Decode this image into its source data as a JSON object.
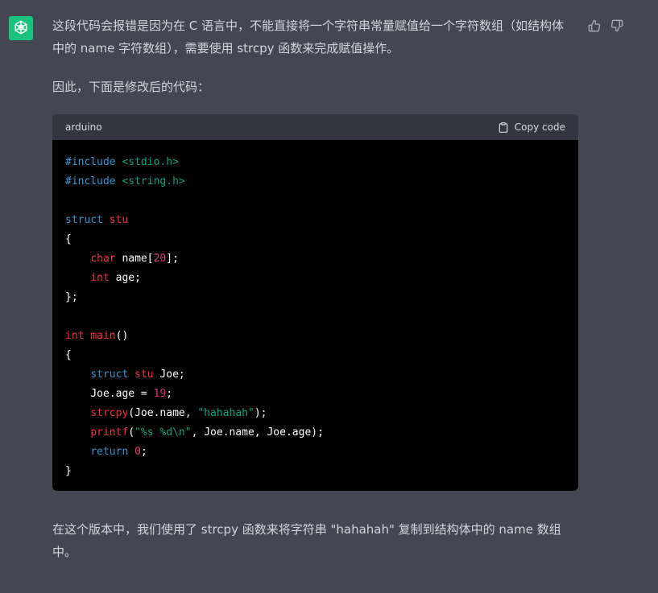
{
  "message": {
    "intro": "这段代码会报错是因为在 C 语言中，不能直接将一个字符串常量赋值给一个字符数组（如结构体中的 name 字符数组），需要使用 strcpy 函数来完成赋值操作。",
    "lead": "因此，下面是修改后的代码：",
    "outro": "在这个版本中，我们使用了 strcpy 函数来将字符串 \"hahahah\" 复制到结构体中的 name 数组中。"
  },
  "code_block": {
    "language": "arduino",
    "copy_label": "Copy code",
    "lines": {
      "l1_kw": "#include",
      "l1_hdr": "<stdio.h>",
      "l2_kw": "#include",
      "l2_hdr": "<string.h>",
      "l4_kw": "struct",
      "l4_name": "stu",
      "l5": "{",
      "l6_type": "char",
      "l6_name": " name[",
      "l6_num": "20",
      "l6_end": "];",
      "l7_type": "int",
      "l7_rest": " age;",
      "l8": "};",
      "l10_type": "int",
      "l10_fn": "main",
      "l10_rest": "()",
      "l11": "{",
      "l12_kw": "struct",
      "l12_type": "stu",
      "l12_rest": " Joe;",
      "l13_a": "Joe.age = ",
      "l13_num": "19",
      "l13_end": ";",
      "l14_fn": "strcpy",
      "l14_a": "(Joe.name, ",
      "l14_str": "\"hahahah\"",
      "l14_end": ");",
      "l15_fn": "printf",
      "l15_a": "(",
      "l15_str": "\"%s %d\\n\"",
      "l15_end": ", Joe.name, Joe.age);",
      "l16_kw": "return",
      "l16_num": "0",
      "l16_end": ";",
      "l17": "}"
    }
  },
  "icons": {
    "avatar": "openai-logo-icon",
    "thumbs_up": "thumbs-up-icon",
    "thumbs_down": "thumbs-down-icon",
    "copy": "clipboard-icon"
  },
  "colors": {
    "background": "#444654",
    "avatar_bg": "#19c37d",
    "code_bg": "#000000",
    "code_header_bg": "#343541",
    "keyword_blue": "#2e95d3",
    "keyword_red": "#f22c3d",
    "number": "#df3079",
    "string": "#00a67d"
  }
}
